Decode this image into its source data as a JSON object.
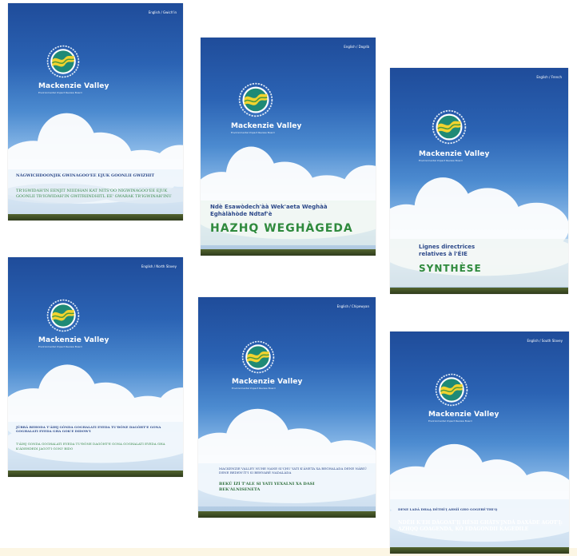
{
  "brand": {
    "name": "Mackenzie Valley",
    "tagline": "Environmental Impact Review Board"
  },
  "covers": [
    {
      "language": "English / Gwich'in",
      "title": "NÀGWICHDOONJIK GWINAGOO'EE EJUK GOONLII GWIZHIT",
      "subtitle": "TR'IGWIDAH'IN EENJIT NIIIDHAN KAT NITS'OO NIGWINAGOO'EE EJUK GOONLII TR'IGWIDAH'IN GWITRIINDHITL EE' GWARAK TR'IGWINAH'INU"
    },
    {
      "language": "English / Dogrib",
      "title": "Ndè Esawòdech'àà Wek'aeta Weghàà Eghàlàhòde Ndtaf'è",
      "subtitle": "HAZHQ WEGHÀGEDA"
    },
    {
      "language": "English / French",
      "title": "Lignes directrices relatives à l'ÉIE",
      "subtitle": "SYNTHÈSE"
    },
    {
      "language": "English / North Slavey",
      "title": "JÚBRÁ BEHODA T'ÁIHJ GÓNDA GOGHALATI EYEDA TU'ÐÓNE DAGÓHT'E GONA GOGHALATI EYEDA GHA GOK'E DIDOW'I",
      "subtitle": "T'ÁIHJ GONDA GOGHALATI EYEDA TU'ÐÓNE DAGÓHT'E GONA GOGHALATI EYEDA GHA K'ÁDEHDEDI JAGOT'I GONI' BIDO"
    },
    {
      "language": "English / Chipewyan",
      "title": "MACKENZIE VALLEY NUHE NANE SI'CHU YATI K'ÁNETA XA BEGHALADA DENE NÁBIÚ DENE BEDEN'ÍT'I SI BEHVARÉ NADALÁDA",
      "subtitle": "BEKÚ ÍZÍ T'ALE SI YATI YEXALNI XA DASI BEK'ÁLNISENETA"
    },
    {
      "language": "English / South Slavey",
      "title": "DENE LADÁ DHAĄ DÉTHÍ'Į AHSÍÍ GHO GOGERÉ'THI'Q",
      "subtitle": "NDÉH K'EH DÁGOAT'Įį HÉSII GHÁTS'JNDÁ DAXÀDE AGOT'Į: AZHQQ GOAGENDA, KÓ EDÁGONDII KAGEDILE"
    }
  ]
}
